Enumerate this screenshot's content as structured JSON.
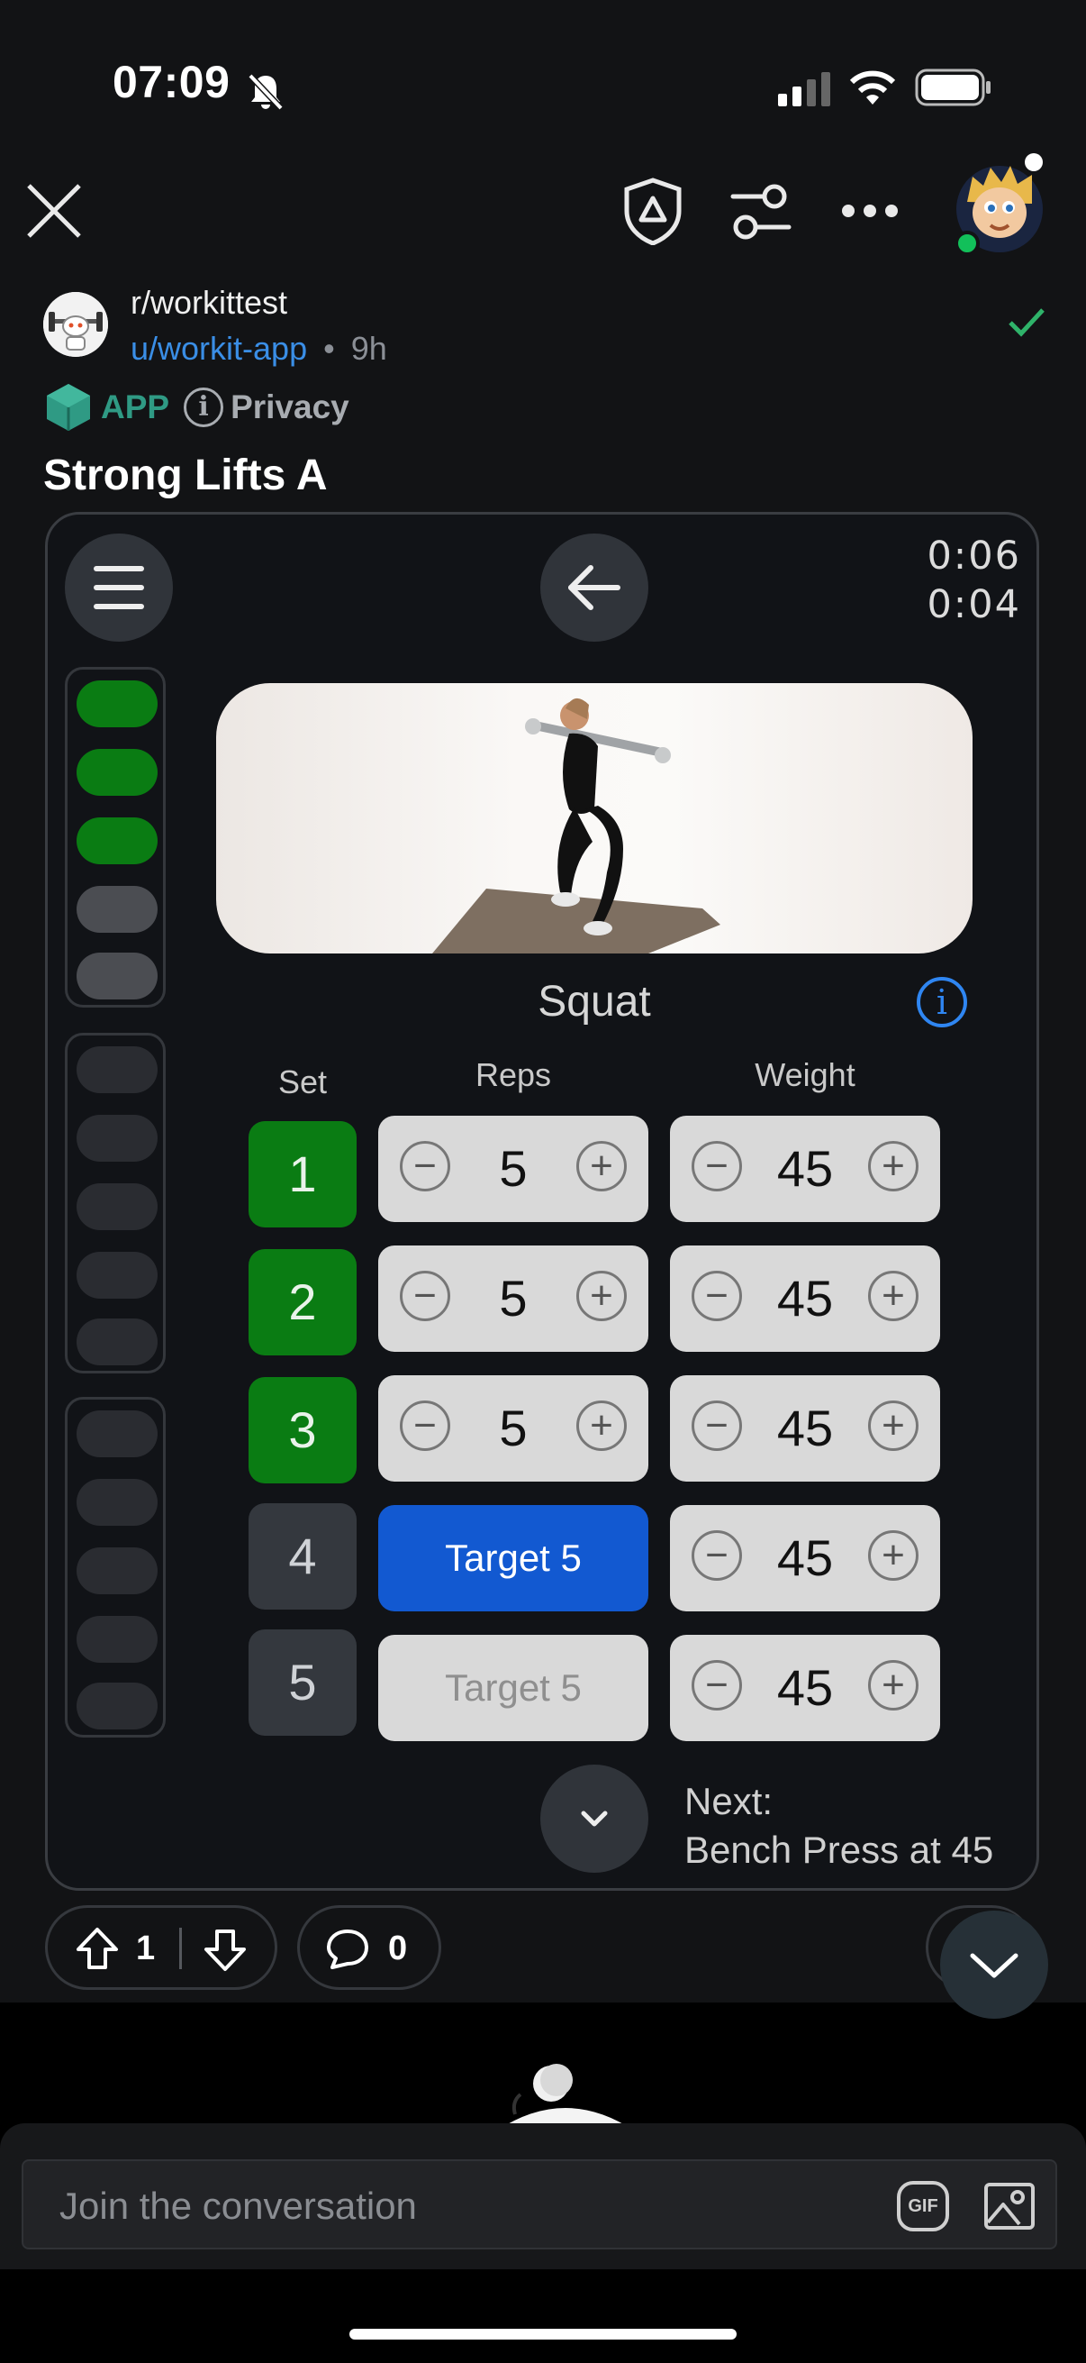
{
  "status_bar": {
    "time": "07:09"
  },
  "post": {
    "subreddit": "r/workittest",
    "author": "u/workit-app",
    "separator": "•",
    "age": "9h",
    "app_badge": "APP",
    "privacy_label": "Privacy",
    "title": "Strong Lifts A"
  },
  "workout": {
    "timer_total": "0:06",
    "timer_set": "0:04",
    "exercise_name": "Squat",
    "headers": {
      "set": "Set",
      "reps": "Reps",
      "weight": "Weight"
    },
    "sets": [
      {
        "number": "1",
        "status": "done",
        "reps": "5",
        "weight": "45"
      },
      {
        "number": "2",
        "status": "done",
        "reps": "5",
        "weight": "45"
      },
      {
        "number": "3",
        "status": "done",
        "reps": "5",
        "weight": "45"
      },
      {
        "number": "4",
        "status": "current",
        "target": "Target 5",
        "weight": "45"
      },
      {
        "number": "5",
        "status": "pending",
        "target": "Target 5",
        "weight": "45"
      }
    ],
    "next_label": "Next:",
    "next_exercise": "Bench Press at 45",
    "progress_groups": [
      [
        "done",
        "done",
        "done",
        "pending",
        "pending"
      ],
      [
        "empty",
        "empty",
        "empty",
        "empty",
        "empty"
      ],
      [
        "empty",
        "empty",
        "empty",
        "empty",
        "empty"
      ]
    ]
  },
  "actions": {
    "upvotes": "1",
    "comments": "0"
  },
  "composer": {
    "placeholder": "Join the conversation",
    "gif_label": "GIF"
  },
  "colors": {
    "done_green": "#0a7c13",
    "active_blue": "#1259d1",
    "link_blue": "#3a8ee6",
    "app_teal": "#2f9a84"
  }
}
